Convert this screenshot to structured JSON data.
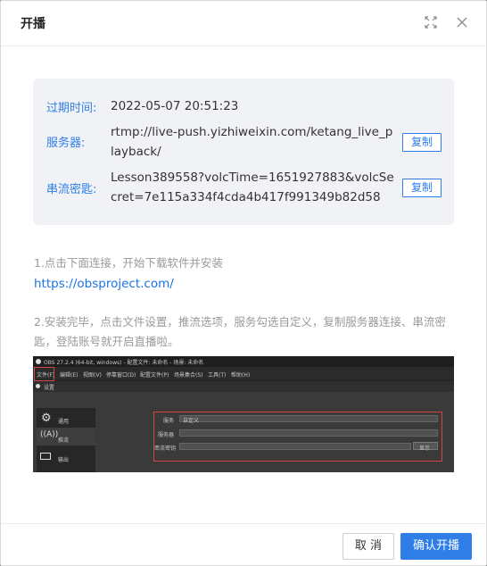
{
  "dialog": {
    "title": "开播",
    "expand_icon": "expand-icon",
    "close_icon": "close-icon"
  },
  "info": {
    "expire_label": "过期时间:",
    "expire_value": "2022-05-07 20:51:23",
    "server_label": "服务器:",
    "server_value": "rtmp://live-push.yizhiweixin.com/ketang_live_playback/",
    "key_label": "串流密匙:",
    "key_value": "Lesson389558?volcTime=1651927883&volcSecret=7e115a334f4cda4b417f991349b82d58",
    "copy_label": "复制"
  },
  "steps": {
    "step1": "1.点击下面连接，开始下载软件并安装",
    "link": "https://obsproject.com/",
    "step2_line1": "2.安装完毕，点击文件设置，推流选项，服务勾选自定义，复制服务器连接、串流密",
    "step2_line2": "匙，登陆账号就开启直播啦。"
  },
  "screenshot": {
    "window_title": "OBS 27.2.4 (64-bit, windows) - 配置文件: 未命名 - 场景: 未命名",
    "menu": [
      "文件(F)",
      "编辑(E)",
      "视图(V)",
      "停靠窗口(D)",
      "配置文件(P)",
      "场景集合(S)",
      "工具(T)",
      "帮助(H)"
    ],
    "settings_title": "设置",
    "sidebar": [
      "通用",
      "推流",
      "输出"
    ],
    "service_label": "服务",
    "service_value": "自定义",
    "server_label": "服务器",
    "key_label": "串流密钥",
    "show_label": "显示"
  },
  "footer": {
    "cancel_label": "取 消",
    "confirm_label": "确认开播"
  },
  "colors": {
    "accent": "#2f7ee8",
    "highlight": "#d64545"
  }
}
